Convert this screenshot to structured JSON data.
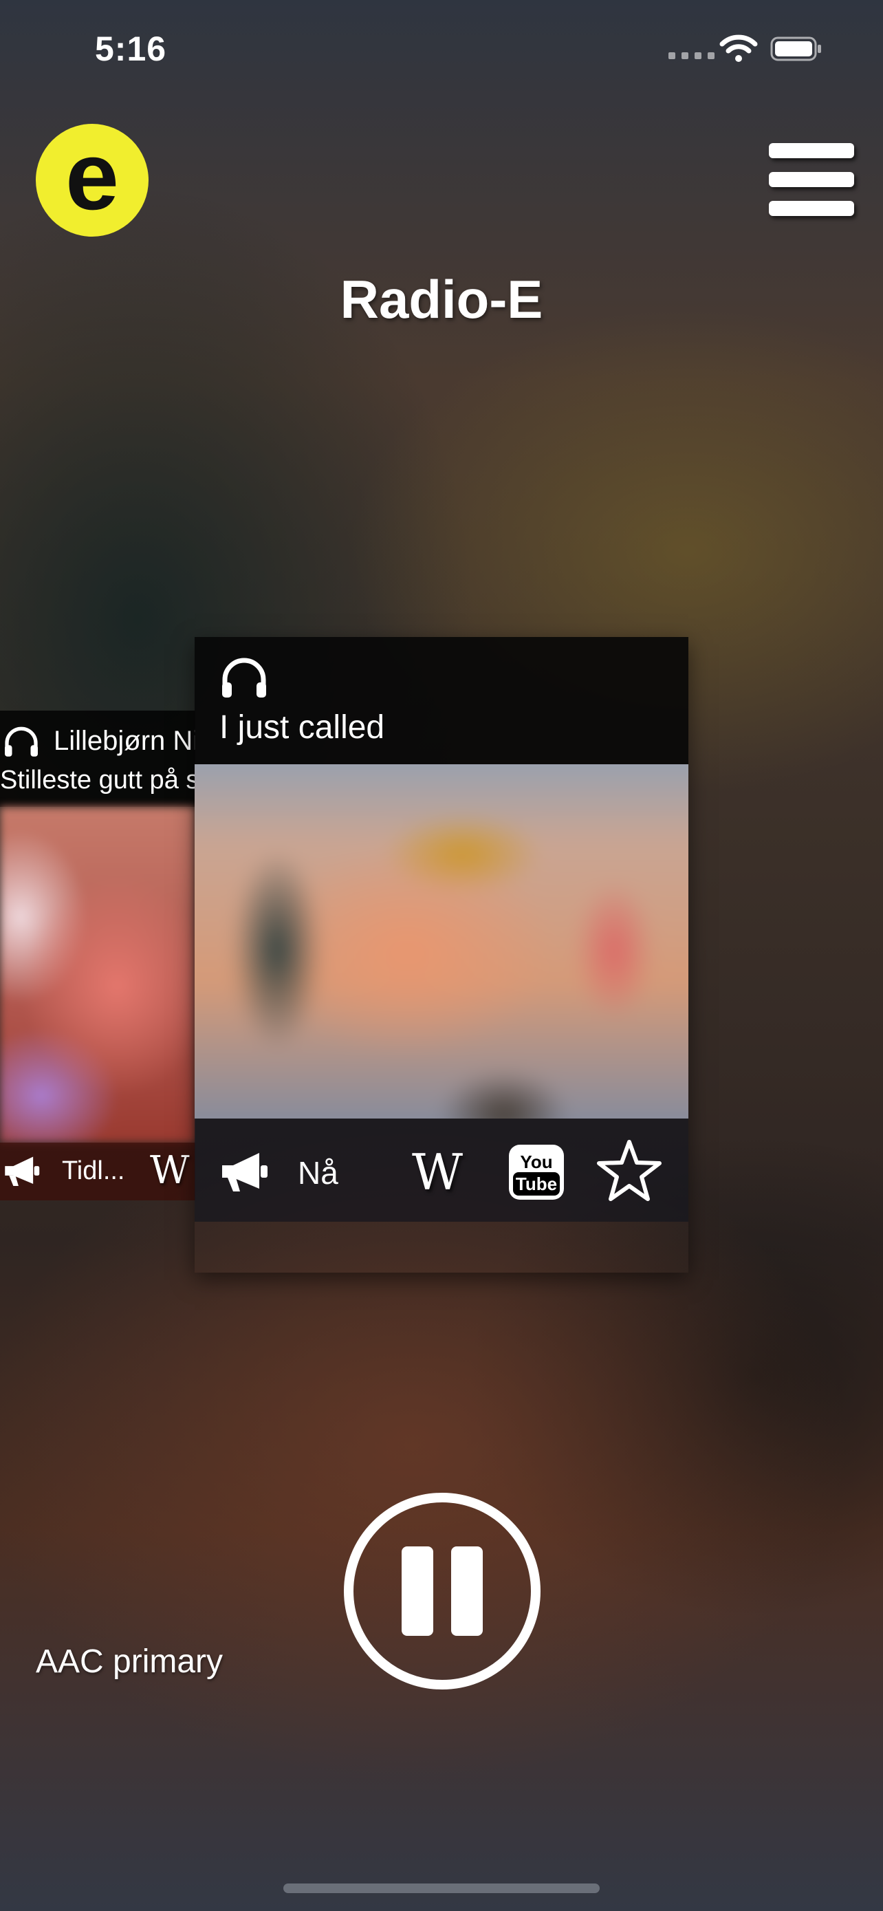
{
  "status_bar": {
    "time": "5:16"
  },
  "header": {
    "title": "Radio-E",
    "logo_letter": "e",
    "logo_color": "#f1ee2e"
  },
  "previous_track": {
    "artist": "Lillebjørn Nilsen",
    "song": "Stilleste gutt på so",
    "footer_label": "Tidl...",
    "wiki_glyph": "W"
  },
  "current_track": {
    "song": "I just called",
    "footer_label": "Nå",
    "wiki_glyph": "W",
    "youtube_top": "You",
    "youtube_bottom": "Tube"
  },
  "player": {
    "stream_quality": "AAC primary",
    "state": "playing"
  },
  "icons": [
    "signal-icon",
    "wifi-icon",
    "battery-icon",
    "menu-icon",
    "headphones-icon",
    "megaphone-icon",
    "wikipedia-icon",
    "youtube-icon",
    "star-icon",
    "pause-icon"
  ]
}
